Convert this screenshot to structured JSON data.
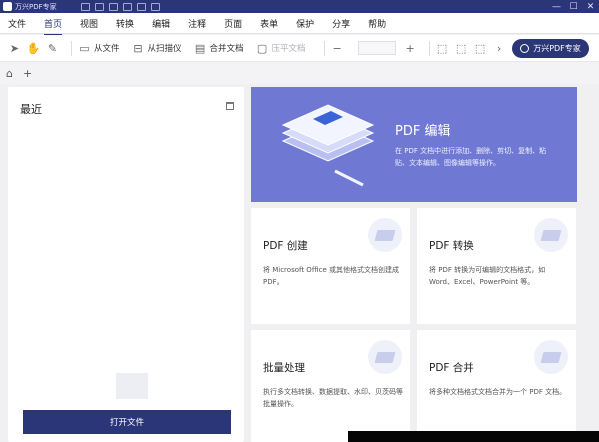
{
  "app": {
    "title": "万兴PDF专家"
  },
  "window_controls": [
    "—",
    "☐",
    "✕"
  ],
  "menu": [
    {
      "label": "文件"
    },
    {
      "label": "首页",
      "active": true
    },
    {
      "label": "视图"
    },
    {
      "label": "转换"
    },
    {
      "label": "编辑"
    },
    {
      "label": "注释"
    },
    {
      "label": "页面"
    },
    {
      "label": "表单"
    },
    {
      "label": "保护"
    },
    {
      "label": "分享"
    },
    {
      "label": "帮助"
    }
  ],
  "toolbar": {
    "from_file": "从文件",
    "from_scanner": "从扫描仪",
    "combine": "合并文档",
    "compress": "压平文档",
    "zoom_out": "−",
    "zoom_in": "+",
    "upgrade": "万兴PDF专家"
  },
  "tabbar": {
    "home": "⌂",
    "add": "+"
  },
  "recent": {
    "title": "最近",
    "open_button": "打开文件"
  },
  "hero": {
    "title": "PDF 编辑",
    "desc": "在 PDF 文档中进行添加、删除、剪切、复制、粘贴、文本编辑、图像编辑等操作。"
  },
  "cards": [
    {
      "title": "PDF 创建",
      "desc": "将 Microsoft Office 或其他格式文档创建成 PDF。"
    },
    {
      "title": "PDF 转换",
      "desc": "将 PDF 转换为可编辑的文档格式，如 Word、Excel、PowerPoint 等。"
    },
    {
      "title": "批量处理",
      "desc": "执行多文档转换、数据提取、水印、贝茨码等批量操作。"
    },
    {
      "title": "PDF 合并",
      "desc": "将多种文档格式文档合并为一个 PDF 文档。"
    }
  ],
  "colors": {
    "brand": "#2b3678",
    "hero_bg": "#6f79d3"
  }
}
